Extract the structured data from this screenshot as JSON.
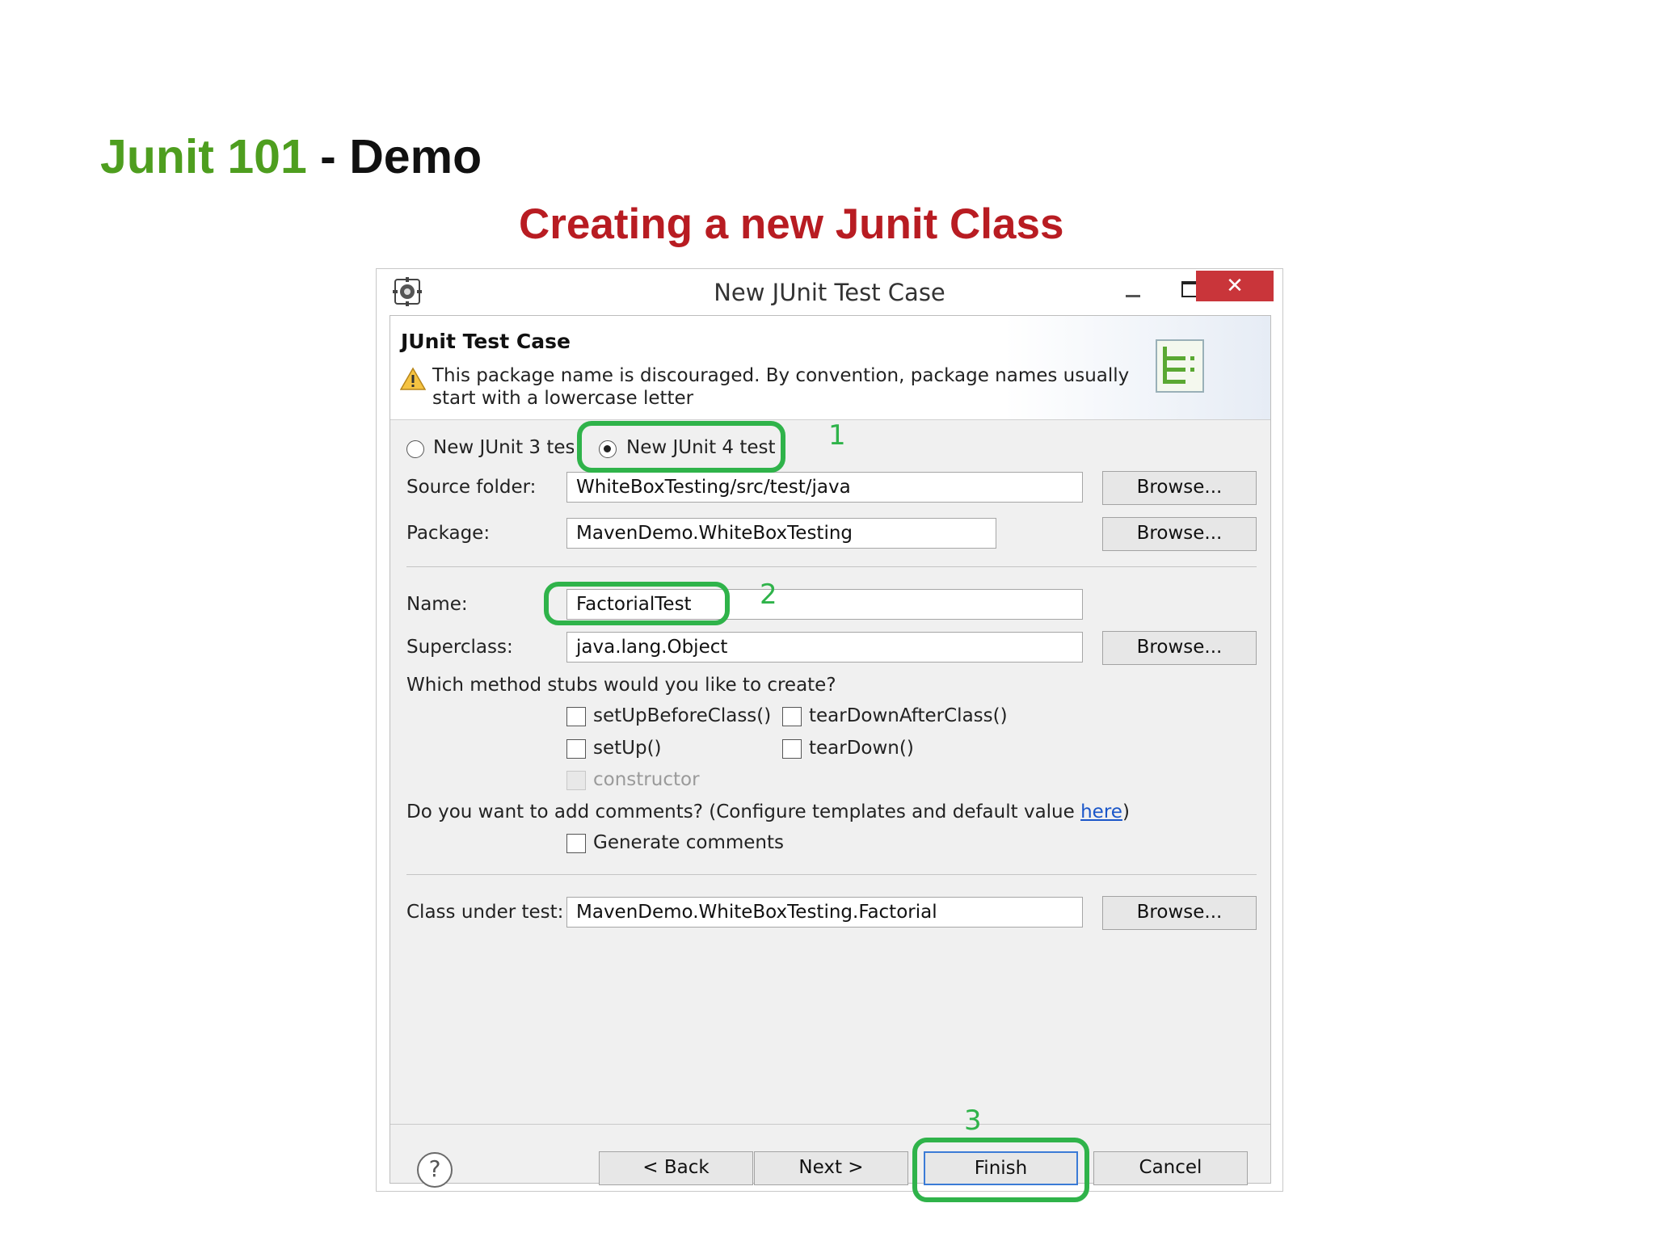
{
  "slide": {
    "title_green": "Junit 101",
    "title_black": " - Demo",
    "subtitle": "Creating a new Junit Class"
  },
  "window": {
    "title": "New JUnit Test Case",
    "close_glyph": "✕"
  },
  "header": {
    "title": "JUnit Test Case",
    "warning_line1": "This package name is discouraged. By convention, package names usually",
    "warning_line2": "start with a lowercase letter"
  },
  "version": {
    "junit3_label": "New JUnit 3 test",
    "junit4_label": "New JUnit 4 test",
    "selected": "junit4"
  },
  "form": {
    "source_folder_label": "Source folder:",
    "source_folder_value": "WhiteBoxTesting/src/test/java",
    "package_label": "Package:",
    "package_value": "MavenDemo.WhiteBoxTesting",
    "name_label": "Name:",
    "name_value": "FactorialTest",
    "superclass_label": "Superclass:",
    "superclass_value": "java.lang.Object",
    "browse_label": "Browse...",
    "stubs_question": "Which method stubs would you like to create?",
    "stub_setup_before_class": "setUpBeforeClass()",
    "stub_teardown_after_class": "tearDownAfterClass()",
    "stub_setup": "setUp()",
    "stub_teardown": "tearDown()",
    "stub_constructor": "constructor",
    "comments_question": "Do you want to add comments? (Configure templates and default value ",
    "comments_link": "here",
    "comments_close": ")",
    "generate_comments": "Generate comments",
    "class_under_test_label": "Class under test:",
    "class_under_test_value": "MavenDemo.WhiteBoxTesting.Factorial"
  },
  "footer": {
    "help_glyph": "?",
    "back_label": "< Back",
    "next_label": "Next >",
    "finish_label": "Finish",
    "cancel_label": "Cancel"
  },
  "annotations": {
    "step1": "1",
    "step2": "2",
    "step3": "3",
    "color": "#2fb34a"
  },
  "colors": {
    "title_green": "#4e9e1f",
    "subtitle_red": "#b81c22",
    "close_red": "#c9353a"
  }
}
